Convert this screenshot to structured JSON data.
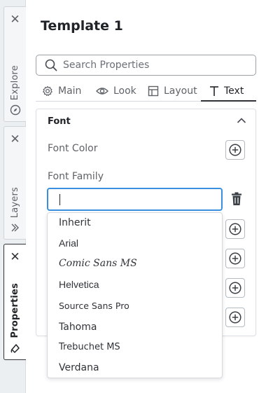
{
  "side_tabs": [
    {
      "label": "Explore",
      "close": "✕",
      "icon": "compass-icon"
    },
    {
      "label": "Layers",
      "close": "✕",
      "icon": "layers-icon"
    },
    {
      "label": "Properties",
      "close": "✕",
      "icon": "paint-bucket-icon"
    }
  ],
  "panel": {
    "title": "Template 1",
    "search": {
      "placeholder": "Search Properties"
    },
    "tabs": [
      {
        "label": "Main",
        "icon": "gear-icon"
      },
      {
        "label": "Look",
        "icon": "eye-icon"
      },
      {
        "label": "Layout",
        "icon": "layout-icon"
      },
      {
        "label": "Text",
        "icon": "text-icon",
        "active": true
      }
    ],
    "font_section": {
      "title": "Font",
      "font_color_label": "Font Color",
      "font_family_label": "Font Family",
      "font_family_value": ""
    },
    "font_options": [
      "Inherit",
      "Arial",
      "Comic Sans MS",
      "Helvetica",
      "Source Sans Pro",
      "Tahoma",
      "Trebuchet MS",
      "Verdana"
    ]
  },
  "colors": {
    "accent": "#3b8fe0",
    "text": "#2f3338",
    "muted": "#5f6368"
  }
}
